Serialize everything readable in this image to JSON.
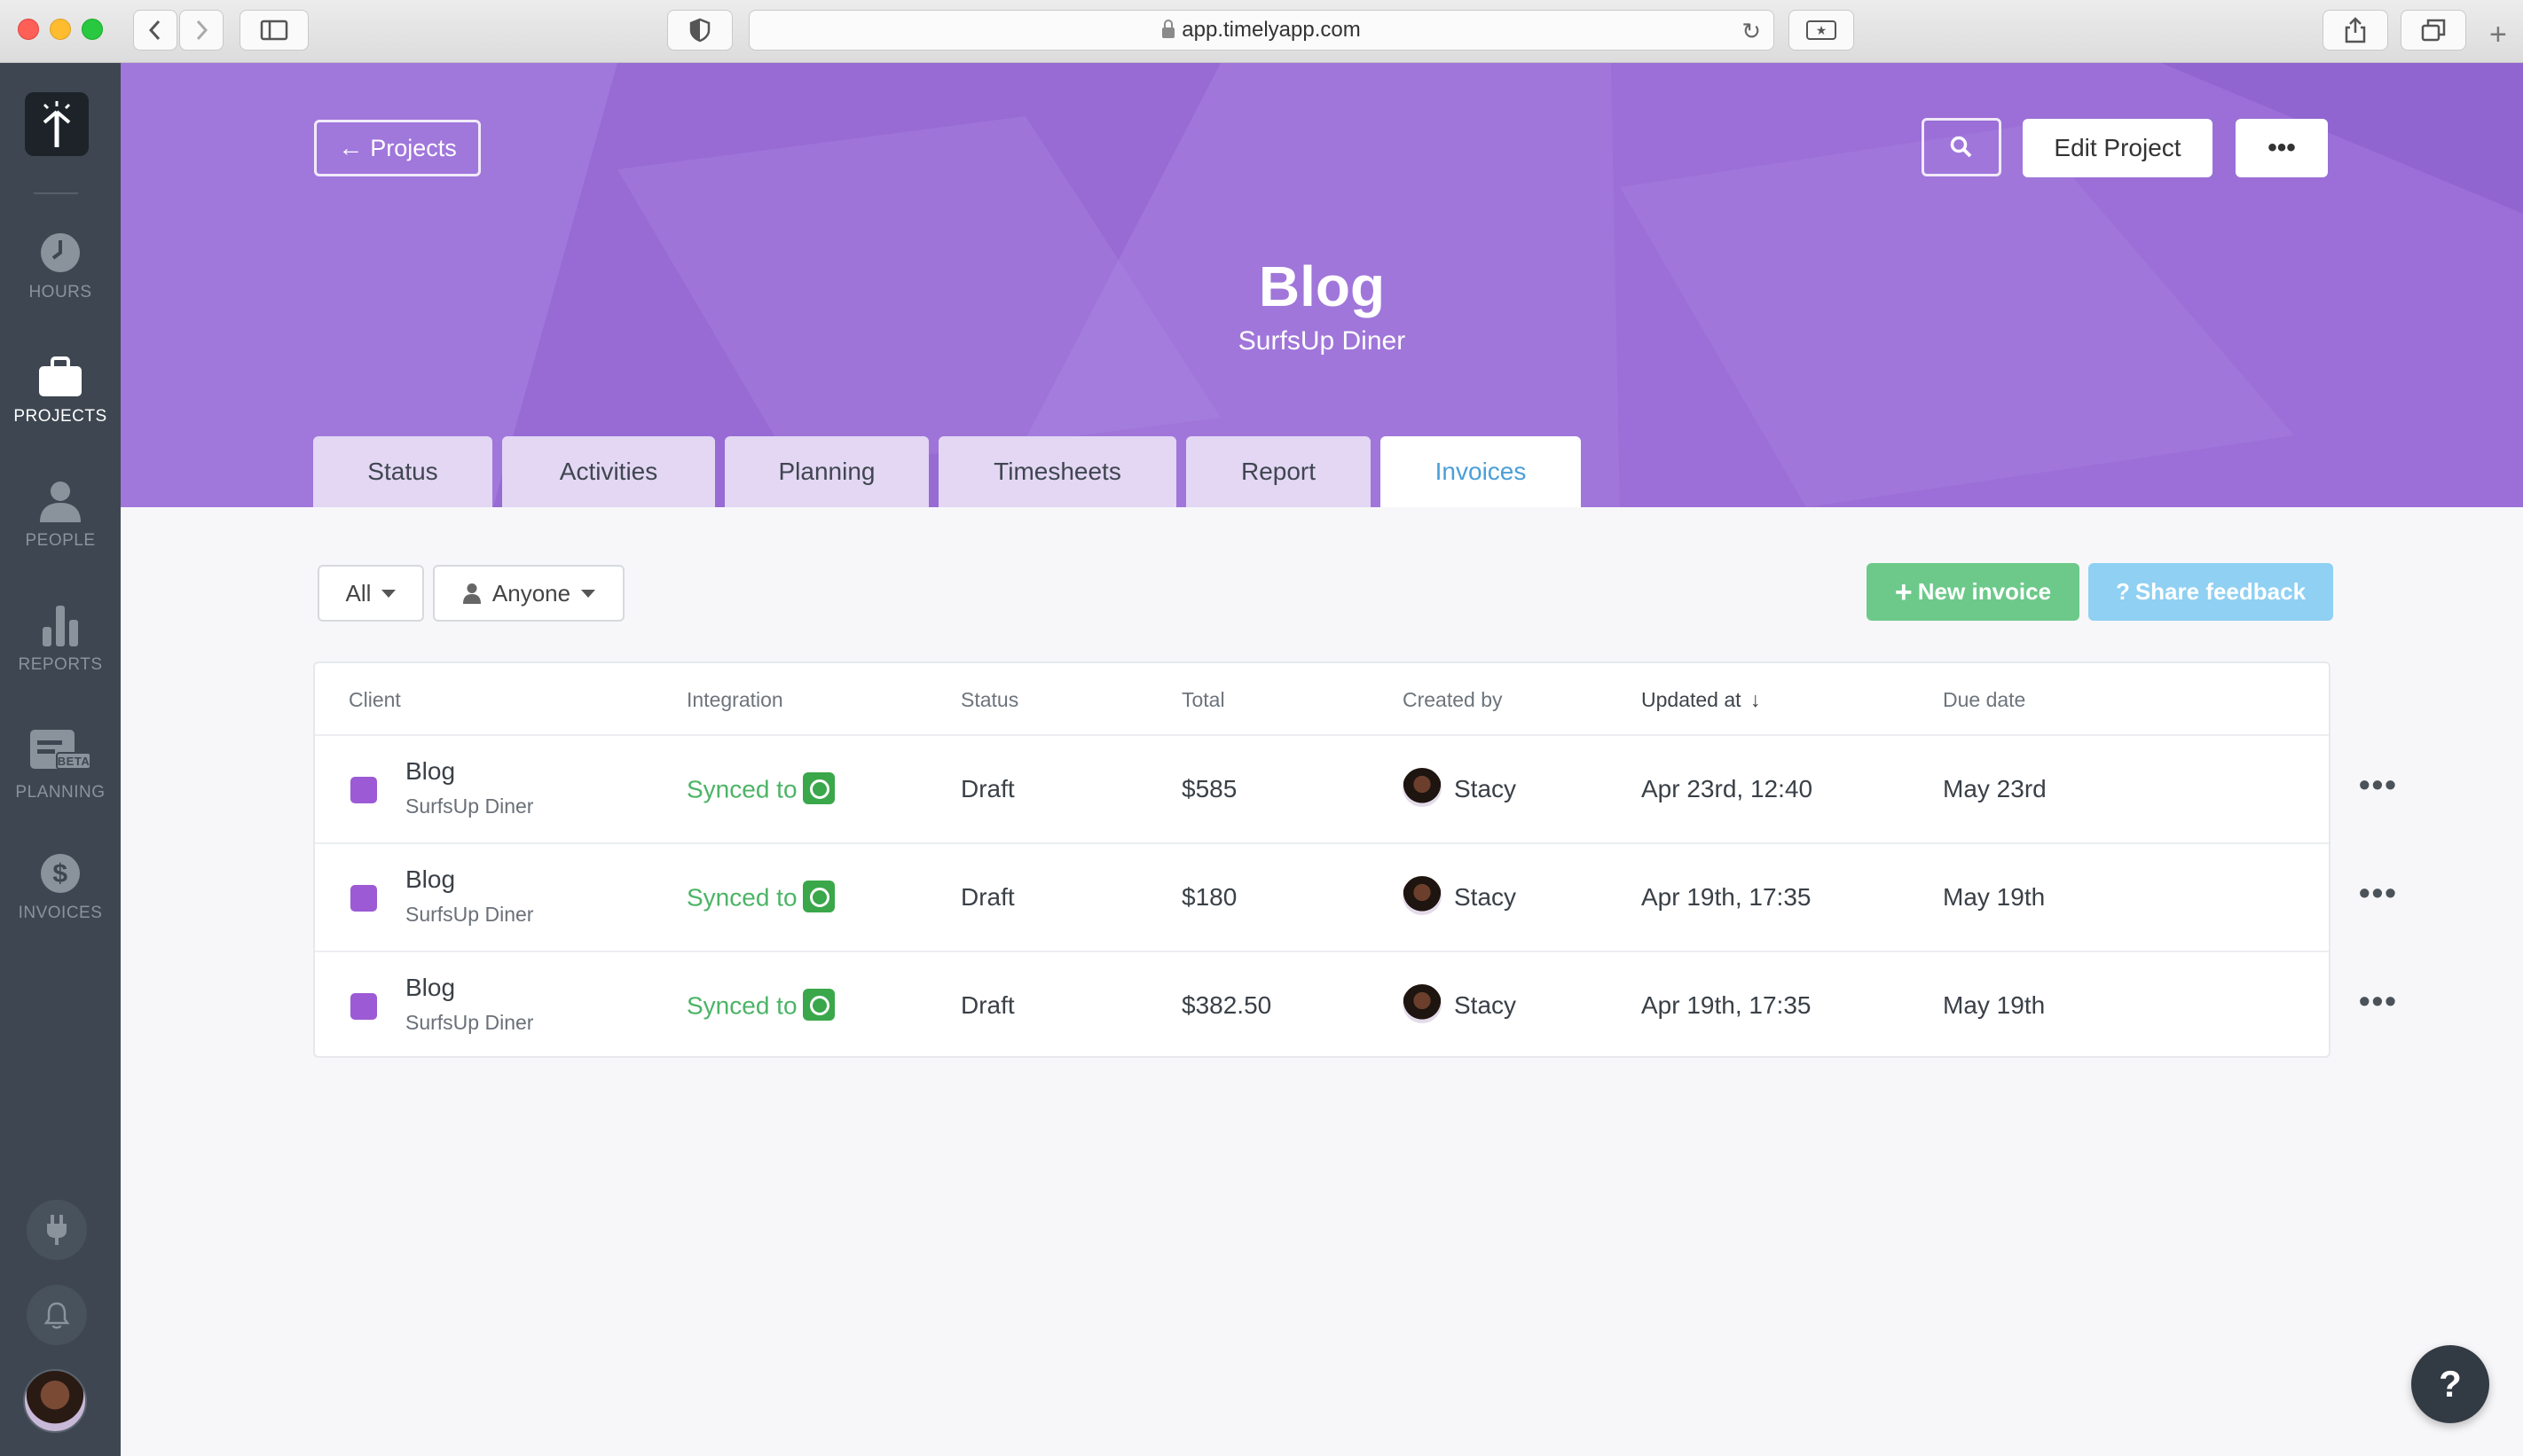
{
  "browser": {
    "url": "app.timelyapp.com"
  },
  "sidebar": {
    "items": [
      {
        "label": "HOURS",
        "icon": "clock-icon"
      },
      {
        "label": "PROJECTS",
        "icon": "briefcase-icon",
        "active": true
      },
      {
        "label": "PEOPLE",
        "icon": "person-icon"
      },
      {
        "label": "REPORTS",
        "icon": "bar-chart-icon"
      },
      {
        "label": "PLANNING",
        "icon": "planning-icon",
        "badge": "BETA"
      },
      {
        "label": "INVOICES",
        "icon": "dollar-icon"
      }
    ],
    "bottom": [
      {
        "icon": "plug-icon"
      },
      {
        "icon": "bell-icon"
      }
    ]
  },
  "header": {
    "back_label": "Projects",
    "edit_label": "Edit Project",
    "more_label": "•••",
    "title": "Blog",
    "subtitle": "SurfsUp Diner"
  },
  "tabs": [
    {
      "label": "Status"
    },
    {
      "label": "Activities"
    },
    {
      "label": "Planning"
    },
    {
      "label": "Timesheets"
    },
    {
      "label": "Report"
    },
    {
      "label": "Invoices",
      "active": true
    }
  ],
  "filters": {
    "status": "All",
    "person": "Anyone"
  },
  "actions": {
    "new_invoice": "New invoice",
    "share_feedback": "Share feedback"
  },
  "table": {
    "columns": [
      "Client",
      "Integration",
      "Status",
      "Total",
      "Created by",
      "Updated at",
      "Due date"
    ],
    "rows": [
      {
        "client": "Blog",
        "client_sub": "SurfsUp Diner",
        "integration": "Synced to",
        "status": "Draft",
        "total": "$585",
        "created_by": "Stacy",
        "updated_at": "Apr 23rd, 12:40",
        "due_date": "May 23rd"
      },
      {
        "client": "Blog",
        "client_sub": "SurfsUp Diner",
        "integration": "Synced to",
        "status": "Draft",
        "total": "$180",
        "created_by": "Stacy",
        "updated_at": "Apr 19th, 17:35",
        "due_date": "May 19th"
      },
      {
        "client": "Blog",
        "client_sub": "SurfsUp Diner",
        "integration": "Synced to",
        "status": "Draft",
        "total": "$382.50",
        "created_by": "Stacy",
        "updated_at": "Apr 19th, 17:35",
        "due_date": "May 19th"
      }
    ],
    "row_menu": "•••"
  },
  "help": {
    "label": "?"
  },
  "colors": {
    "sidebar": "#3e4751",
    "hero": "#9b6fd6",
    "tab": "#e3d7f4",
    "active_tab_text": "#4a9fd8",
    "new_invoice": "#6cc98a",
    "share_feedback": "#8fd0f3",
    "synced": "#4cb466",
    "swatch": "#9c5ad5"
  }
}
